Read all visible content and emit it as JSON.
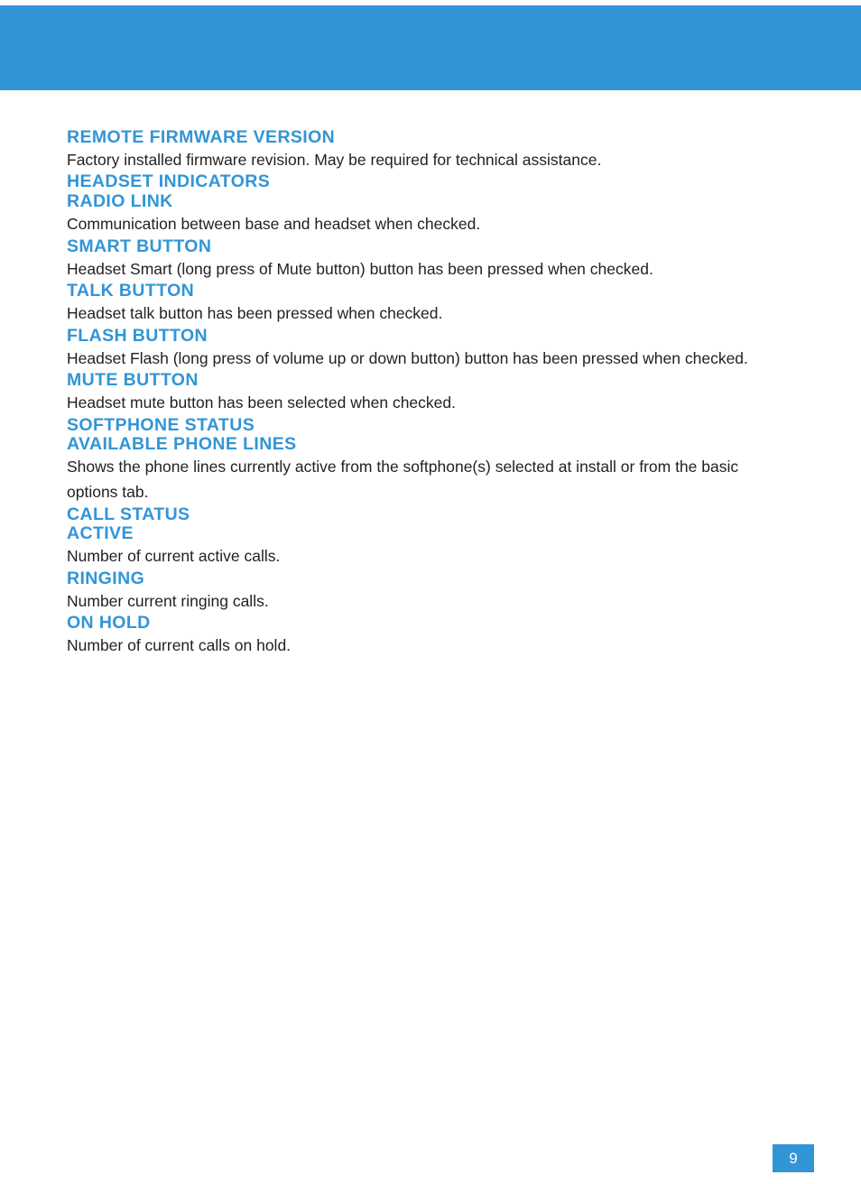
{
  "theme": {
    "accent": "#3295d6",
    "body_text": "#231f20",
    "page_background": "#ffffff"
  },
  "header": {
    "band_label": "decorative-blue-band"
  },
  "sections": [
    {
      "id": "remote-firmware-version",
      "level": "sub",
      "heading": "REMOTE FIRMWARE VERSION",
      "body": "Factory installed firmware revision. May be required for technical assistance.",
      "spacing": "first"
    },
    {
      "id": "headset-indicators",
      "level": "section",
      "heading": "HEADSET INDICATORS",
      "body": "",
      "spacing": "text-to-head"
    },
    {
      "id": "radio-link",
      "level": "sub",
      "heading": "RADIO LINK",
      "body": "Communication between base and headset when checked.",
      "spacing": "head-to-head"
    },
    {
      "id": "smart-button",
      "level": "sub",
      "heading": "SMART BUTTON",
      "body": "Headset Smart (long press of Mute button) button has been pressed when checked.",
      "spacing": "text-to-head"
    },
    {
      "id": "talk-button",
      "level": "sub",
      "heading": "TALK BUTTON",
      "body": "Headset talk button has been pressed when checked.",
      "spacing": "text-to-head"
    },
    {
      "id": "flash-button",
      "level": "sub",
      "heading": "FLASH BUTTON",
      "body": "Headset Flash (long press of volume up or down button) button has been pressed when checked.",
      "spacing": "text-to-head"
    },
    {
      "id": "mute-button",
      "level": "sub",
      "heading": "MUTE BUTTON",
      "body": "Headset mute button has been selected when checked.",
      "spacing": "text-to-head"
    },
    {
      "id": "softphone-status",
      "level": "section",
      "heading": "SOFTPHONE STATUS",
      "body": "",
      "spacing": "major"
    },
    {
      "id": "available-phone-lines",
      "level": "sub",
      "heading": "AVAILABLE PHONE LINES",
      "body": "Shows the phone lines currently active from the softphone(s) selected at install or from the basic options tab.",
      "spacing": "head-to-head"
    },
    {
      "id": "call-status",
      "level": "section",
      "heading": "CALL STATUS",
      "body": "",
      "spacing": "major"
    },
    {
      "id": "active",
      "level": "sub",
      "heading": "ACTIVE",
      "body": "Number of current active calls.",
      "spacing": "head-to-head"
    },
    {
      "id": "ringing",
      "level": "sub",
      "heading": "RINGING",
      "body": "Number current ringing calls.",
      "spacing": "text-to-head"
    },
    {
      "id": "on-hold",
      "level": "sub",
      "heading": "ON HOLD",
      "body": "Number of current calls on hold.",
      "spacing": "text-to-head"
    }
  ],
  "footer": {
    "page_number": "9"
  }
}
